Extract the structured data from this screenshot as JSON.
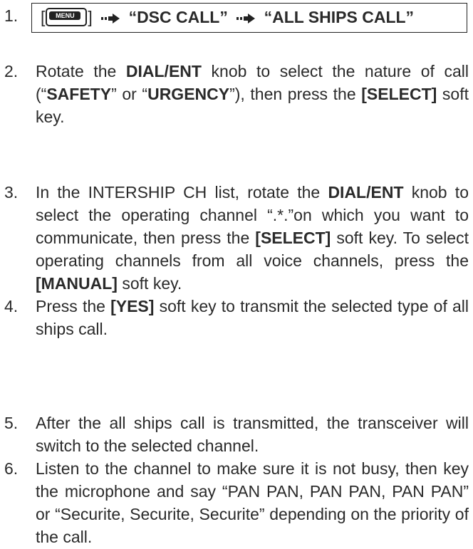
{
  "steps": [
    {
      "number": "1.",
      "bracket_open": "[",
      "menu_key": "MENU",
      "bracket_close": "]",
      "item1": "“DSC CALL”",
      "item2": "“ALL SHIPS CALL”"
    },
    {
      "number": "2.",
      "t1": "Rotate the ",
      "b1": "DIAL/ENT",
      "t2": " knob to select the nature of call (“",
      "b2": "SAFETY",
      "t3": "” or “",
      "b3": "URGENCY",
      "t4": "”), then press the ",
      "b4": "[SELECT]",
      "t5": " soft key."
    },
    {
      "number": "3.",
      "t1": "In the INTERSHIP CH list, rotate the ",
      "b1": "DIAL/ENT",
      "t2": " knob to select the operating channel “.*.”on which you want to communicate, then press the ",
      "b2": "[SELECT]",
      "t3": " soft key. To select operating channels from all voice channels, press the ",
      "b3": "[MANUAL]",
      "t4": " soft key."
    },
    {
      "number": "4.",
      "t1": "Press the ",
      "b1": "[YES]",
      "t2": " soft key to transmit the selected type of all ships call."
    },
    {
      "number": "5.",
      "t1": "After the all ships call is transmitted, the transceiver will switch to the selected channel."
    },
    {
      "number": "6.",
      "t1": "Listen to the channel to make sure it is not busy, then key the microphone and say “PAN PAN, PAN PAN, PAN PAN” or “Securite, Securite, Securite” depending on the priority of the call."
    }
  ]
}
